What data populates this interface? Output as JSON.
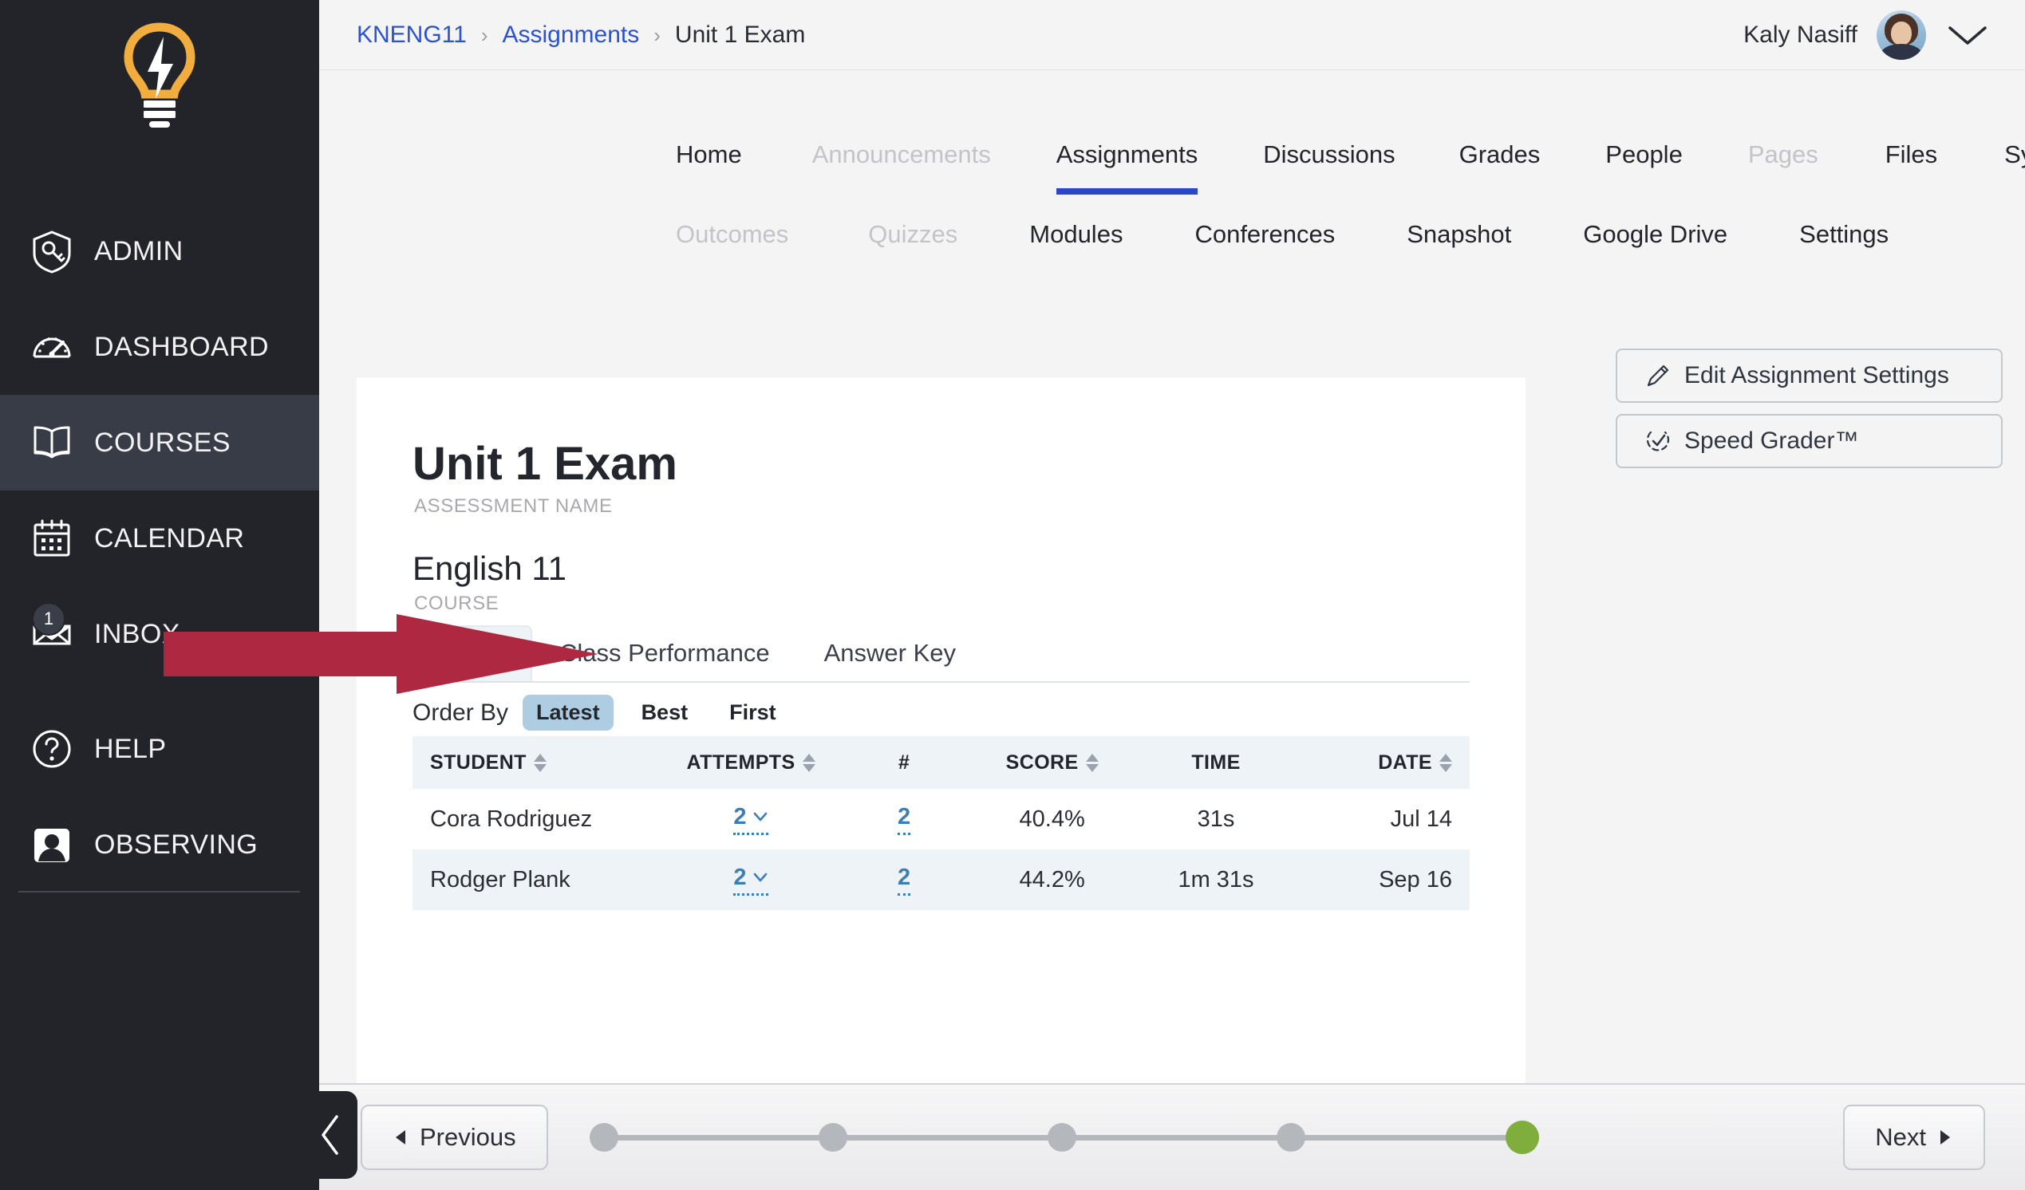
{
  "sidebar": {
    "logo_icon": "lightbulb-bolt-logo",
    "items": [
      {
        "label": "ADMIN",
        "icon": "shield-key-icon",
        "active": false,
        "badge": null
      },
      {
        "label": "DASHBOARD",
        "icon": "speedometer-icon",
        "active": false,
        "badge": null
      },
      {
        "label": "COURSES",
        "icon": "book-icon",
        "active": true,
        "badge": null
      },
      {
        "label": "CALENDAR",
        "icon": "calendar-icon",
        "active": false,
        "badge": null
      },
      {
        "label": "INBOX",
        "icon": "envelope-icon",
        "active": false,
        "badge": "1"
      },
      {
        "label": "HELP",
        "icon": "question-mark-icon",
        "active": false,
        "badge": null
      },
      {
        "label": "OBSERVING",
        "icon": "user-avatar-icon",
        "active": false,
        "badge": null
      }
    ],
    "collapse_icon": "chevron-left-icon"
  },
  "topbar": {
    "breadcrumb": [
      {
        "label": "KNENG11",
        "type": "link"
      },
      {
        "label": "Assignments",
        "type": "link"
      },
      {
        "label": "Unit 1 Exam",
        "type": "current"
      }
    ],
    "separator": "›",
    "user_name": "Kaly Nasiff",
    "avatar_icon": "user-avatar",
    "user_menu_icon": "chevron-down-icon"
  },
  "course_nav": {
    "row1": [
      {
        "label": "Home",
        "state": "normal"
      },
      {
        "label": "Announcements",
        "state": "muted"
      },
      {
        "label": "Assignments",
        "state": "active"
      },
      {
        "label": "Discussions",
        "state": "normal"
      },
      {
        "label": "Grades",
        "state": "normal"
      },
      {
        "label": "People",
        "state": "normal"
      },
      {
        "label": "Pages",
        "state": "muted"
      },
      {
        "label": "Files",
        "state": "normal"
      },
      {
        "label": "Syllabus",
        "state": "normal"
      }
    ],
    "row2": [
      {
        "label": "Outcomes",
        "state": "muted"
      },
      {
        "label": "Quizzes",
        "state": "muted"
      },
      {
        "label": "Modules",
        "state": "normal"
      },
      {
        "label": "Conferences",
        "state": "normal"
      },
      {
        "label": "Snapshot",
        "state": "normal"
      },
      {
        "label": "Google Drive",
        "state": "normal"
      },
      {
        "label": "Settings",
        "state": "normal"
      }
    ]
  },
  "actions": [
    {
      "label": "Edit Assignment Settings",
      "icon": "pencil-icon"
    },
    {
      "label": "Speed Grader™",
      "icon": "speed-grader-icon"
    }
  ],
  "card": {
    "assessment_name": "Unit 1 Exam",
    "assessment_caption": "ASSESSMENT NAME",
    "course_name": "English 11",
    "course_caption": "COURSE",
    "tabs": [
      {
        "label": "",
        "selected": true
      },
      {
        "label": "Class Performance",
        "selected": false
      },
      {
        "label": "Answer Key",
        "selected": false
      }
    ],
    "order_by": {
      "label": "Order By",
      "options": [
        {
          "label": "Latest",
          "selected": true
        },
        {
          "label": "Best",
          "selected": false
        },
        {
          "label": "First",
          "selected": false
        }
      ]
    },
    "table": {
      "columns": [
        {
          "label": "STUDENT",
          "sortable": true,
          "align": "left"
        },
        {
          "label": "ATTEMPTS",
          "sortable": true,
          "align": "center"
        },
        {
          "label": "#",
          "sortable": false,
          "align": "center"
        },
        {
          "label": "SCORE",
          "sortable": true,
          "align": "center"
        },
        {
          "label": "TIME",
          "sortable": false,
          "align": "center"
        },
        {
          "label": "DATE",
          "sortable": true,
          "align": "right"
        }
      ],
      "rows": [
        {
          "student": "Cora Rodriguez",
          "attempts": "2",
          "number": "2",
          "score": "40.4%",
          "time": "31s",
          "date": "Jul 14"
        },
        {
          "student": "Rodger Plank",
          "attempts": "2",
          "number": "2",
          "score": "44.2%",
          "time": "1m 31s",
          "date": "Sep 16"
        }
      ]
    }
  },
  "bottombar": {
    "previous_label": "Previous",
    "next_label": "Next",
    "prev_icon": "triangle-left-icon",
    "next_icon": "triangle-right-icon",
    "progress": {
      "total": 5,
      "current": 5
    }
  },
  "annotation": {
    "type": "arrow-right",
    "color": "#AE2841",
    "points_at": "class-performance-tab"
  },
  "colors": {
    "sidebar_bg": "#22242a",
    "sidebar_active": "#383c47",
    "accent_blue": "#2b47cc",
    "link_blue": "#2b52cf",
    "table_link": "#3b7fb5",
    "pill_blue": "#aecde2",
    "table_stripe": "#eef3f8",
    "progress_done": "#7fae3c",
    "logo_yellow": "#f1ad3e",
    "arrow_red": "#AE2841"
  }
}
